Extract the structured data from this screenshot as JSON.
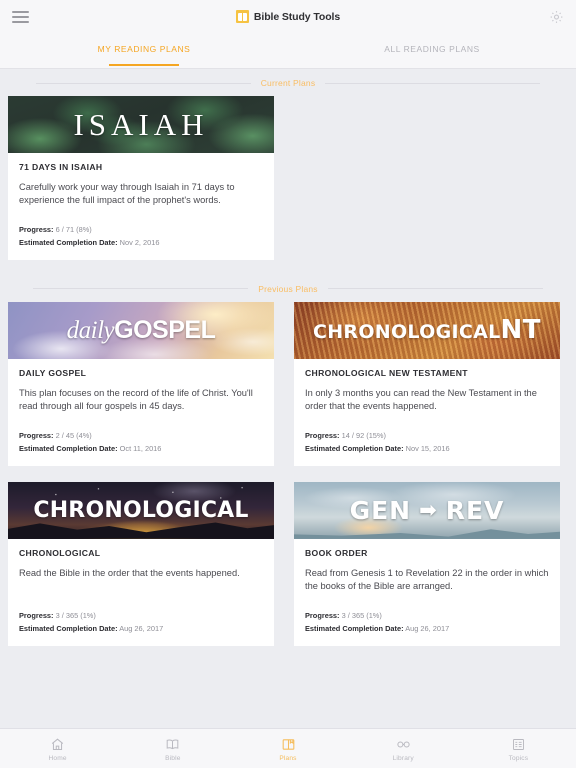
{
  "header": {
    "brand_title": "Bible Study Tools",
    "menu_icon": "hamburger-icon",
    "settings_icon": "gear-icon"
  },
  "tabs": [
    {
      "label": "MY READING PLANS",
      "active": true
    },
    {
      "label": "ALL READING PLANS",
      "active": false
    }
  ],
  "sections": [
    {
      "label": "Current Plans"
    },
    {
      "label": "Previous Plans"
    }
  ],
  "meta_labels": {
    "progress": "Progress:",
    "completion": "Estimated Completion Date:"
  },
  "current_plans": [
    {
      "banner_text": "ISAIAH",
      "title": "71 DAYS IN ISAIAH",
      "description": "Carefully work your way through Isaiah in 71 days to experience the full impact of the prophet's words.",
      "progress": "6 / 71  (8%)",
      "completion_date": "Nov 2, 2016"
    }
  ],
  "previous_plans": [
    {
      "banner_text_light": "daily",
      "banner_text_bold": "GOSPEL",
      "title": "DAILY GOSPEL",
      "description": "This plan focuses on the record of the life of Christ. You'll read through all four gospels in 45 days.",
      "progress": "2 / 45  (4%)",
      "completion_date": "Oct 11, 2016"
    },
    {
      "banner_text_light": "CHRONOLOGICAL",
      "banner_text_bold": "NT",
      "title": "CHRONOLOGICAL NEW TESTAMENT",
      "description": "In only 3 months you can read the New Testament in the order that the events happened.",
      "progress": "14 / 92  (15%)",
      "completion_date": "Nov 15, 2016"
    },
    {
      "banner_text": "CHRONOLOGICAL",
      "title": "CHRONOLOGICAL",
      "description": "Read the Bible in the order that the events happened.",
      "progress": "3 / 365  (1%)",
      "completion_date": "Aug 26, 2017"
    },
    {
      "banner_text_light": "GEN",
      "banner_arrow": "➡",
      "banner_text_bold": "REV",
      "title": "BOOK ORDER",
      "description": "Read from Genesis 1 to Revelation 22 in the order in which the books of the Bible are arranged.",
      "progress": "3 / 365  (1%)",
      "completion_date": "Aug 26, 2017"
    }
  ],
  "bottom_nav": [
    {
      "label": "Home",
      "icon": "home-icon",
      "active": false
    },
    {
      "label": "Bible",
      "icon": "book-icon",
      "active": false
    },
    {
      "label": "Plans",
      "icon": "plans-icon",
      "active": true
    },
    {
      "label": "Library",
      "icon": "glasses-icon",
      "active": false
    },
    {
      "label": "Topics",
      "icon": "list-icon",
      "active": false
    }
  ],
  "colors": {
    "accent": "#f5a623",
    "accent_light": "#f9bd63",
    "page_bg": "#ecedf1",
    "card_bg": "#ffffff",
    "brand_yellow": "#f6c343"
  }
}
